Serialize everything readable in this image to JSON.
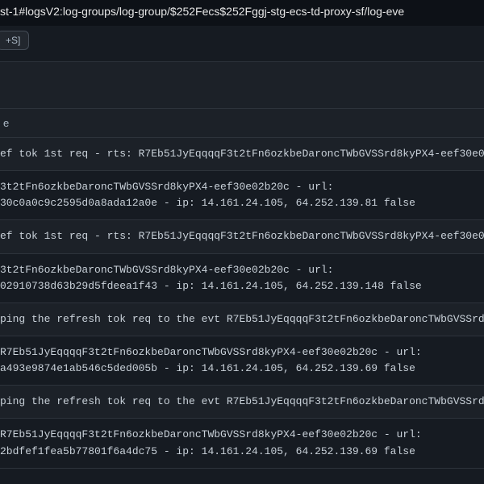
{
  "browser": {
    "url_fragment": "st-1#logsV2:log-groups/log-group/$252Fecs$252Fggj-stg-ecs-td-proxy-sf/log-eve"
  },
  "shortcut": {
    "label": "+S]"
  },
  "columns": {
    "message_header": "e"
  },
  "logs": [
    "ef tok 1st req - rts: R7Eb51JyEqqqqF3t2tFn6ozkbeDaroncTWbGVSSrd8kyPX4-eef30e0",
    "3t2tFn6ozkbeDaroncTWbGVSSrd8kyPX4-eef30e02b20c - url:\n30c0a0c9c2595d0a8ada12a0e - ip: 14.161.24.105, 64.252.139.81 false",
    "ef tok 1st req - rts: R7Eb51JyEqqqqF3t2tFn6ozkbeDaroncTWbGVSSrd8kyPX4-eef30e0",
    "3t2tFn6ozkbeDaroncTWbGVSSrd8kyPX4-eef30e02b20c - url:\n02910738d63b29d5fdeea1f43 - ip: 14.161.24.105, 64.252.139.148 false",
    "ping the refresh tok req to the evt R7Eb51JyEqqqqF3t2tFn6ozkbeDaroncTWbGVSSrd",
    "R7Eb51JyEqqqqF3t2tFn6ozkbeDaroncTWbGVSSrd8kyPX4-eef30e02b20c - url:\na493e9874e1ab546c5ded005b - ip: 14.161.24.105, 64.252.139.69 false",
    "ping the refresh tok req to the evt R7Eb51JyEqqqqF3t2tFn6ozkbeDaroncTWbGVSSrd",
    "R7Eb51JyEqqqqF3t2tFn6ozkbeDaroncTWbGVSSrd8kyPX4-eef30e02b20c - url:\n2bdfef1fea5b77801f6a4dc75 - ip: 14.161.24.105, 64.252.139.69 false"
  ]
}
